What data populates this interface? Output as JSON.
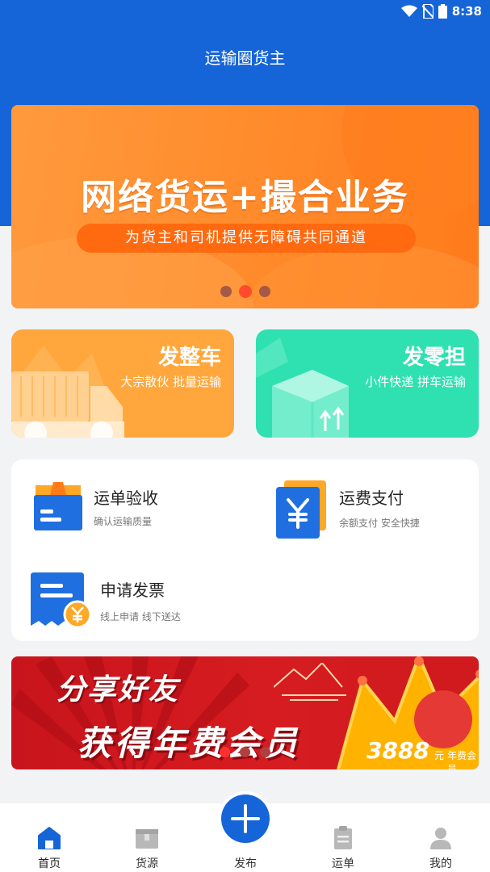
{
  "status_bar": {
    "time": "8:38",
    "icons": [
      "wifi-icon",
      "no-sim-icon",
      "battery-icon"
    ]
  },
  "header": {
    "title": "运输圈货主"
  },
  "banner": {
    "headline": "网络货运+撮合业务",
    "tagline": "为货主和司机提供无障碍共同通道",
    "dots_count": 3,
    "active_dot": 1
  },
  "services": [
    {
      "title": "发整车",
      "subtitle": "大宗散伙 批量运输",
      "icon": "truck-icon",
      "color": "#ffa73d"
    },
    {
      "title": "发零担",
      "subtitle": "小件快递 拼车运输",
      "icon": "package-icon",
      "color": "#2fe0b0"
    }
  ],
  "features": [
    {
      "title": "运单验收",
      "subtitle": "确认运输质量",
      "icon": "box-icon"
    },
    {
      "title": "运费支付",
      "subtitle": "余额支付 安全快捷",
      "icon": "yen-card-icon"
    },
    {
      "title": "申请发票",
      "subtitle": "线上申请 线下送达",
      "icon": "invoice-icon"
    }
  ],
  "promo": {
    "line1": "分享好友",
    "line2": "获得年费会员",
    "price": "3888",
    "unit": "元",
    "member_label": "年费会员",
    "dots_count": 3,
    "active_dot": 0
  },
  "tabbar": {
    "tabs": [
      {
        "label": "首页",
        "icon": "home-icon",
        "active": true
      },
      {
        "label": "货源",
        "icon": "cargo-source-icon",
        "active": false
      },
      {
        "label": "发布",
        "icon": "plus-icon",
        "active": false
      },
      {
        "label": "运单",
        "icon": "waybill-icon",
        "active": false
      },
      {
        "label": "我的",
        "icon": "user-icon",
        "active": false
      }
    ]
  },
  "colors": {
    "primary": "#1565d8",
    "banner_orange": "#ff8a2a",
    "promo_red": "#d61c20"
  }
}
